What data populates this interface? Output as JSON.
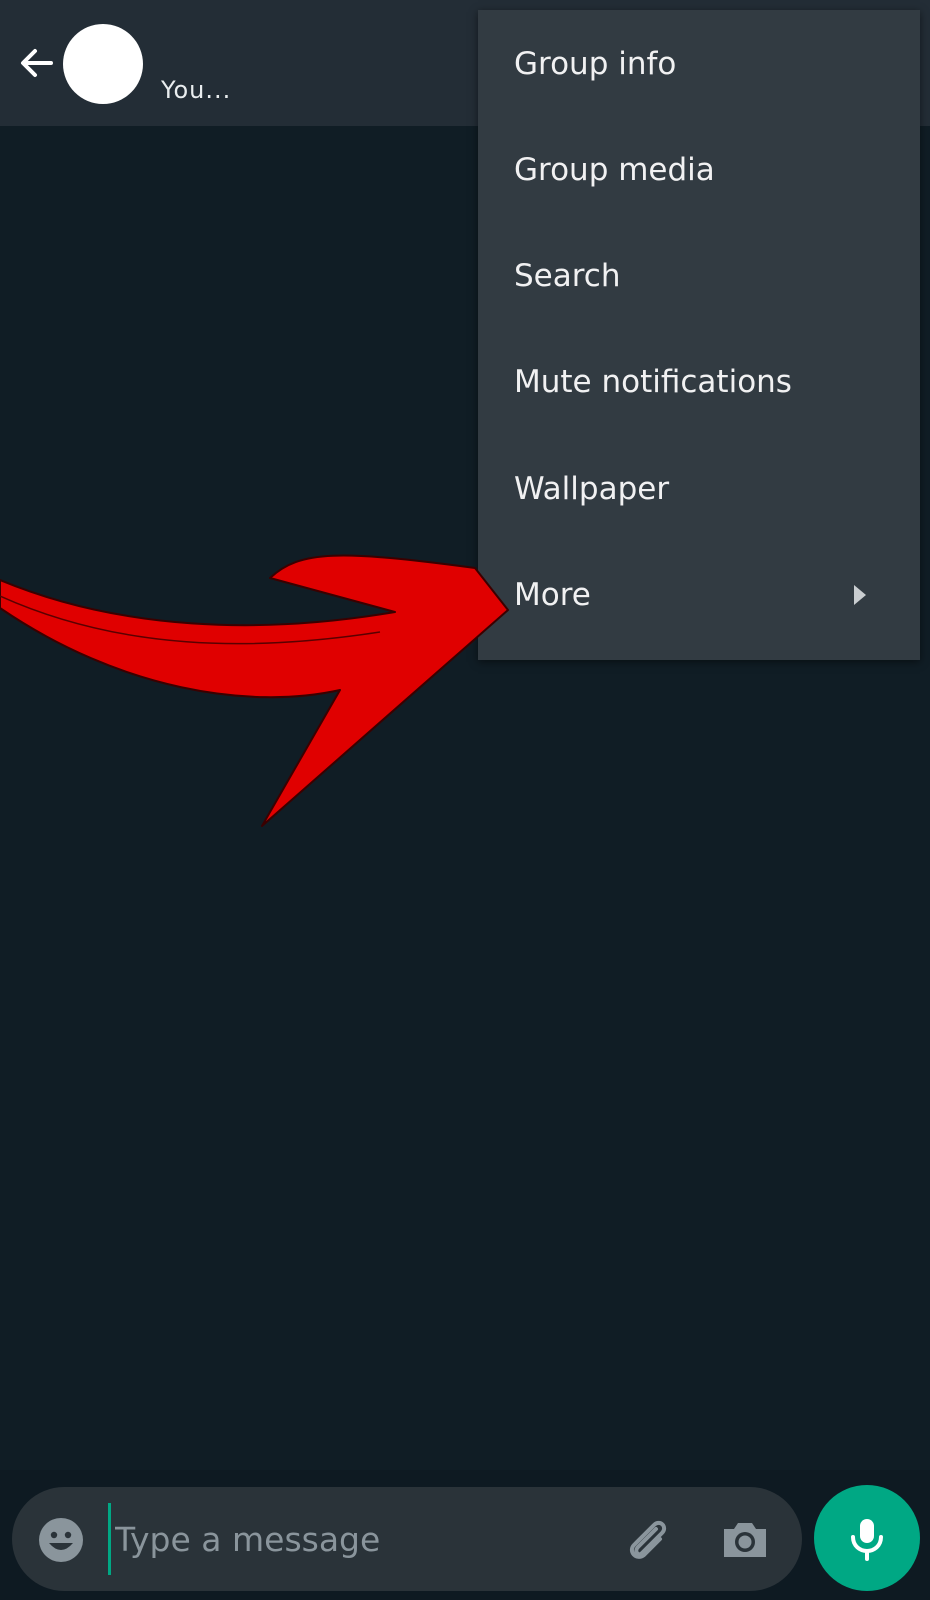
{
  "header": {
    "subtitle": "You..."
  },
  "menu": {
    "items": [
      {
        "label": "Group info"
      },
      {
        "label": "Group media"
      },
      {
        "label": "Search"
      },
      {
        "label": "Mute notifications"
      },
      {
        "label": "Wallpaper"
      },
      {
        "label": "More",
        "has_submenu": true
      }
    ]
  },
  "composer": {
    "placeholder": "Type a message"
  },
  "colors": {
    "background": "#101d25",
    "header": "#232d36",
    "menu": "#323b42",
    "accent": "#00a884",
    "annotation_arrow": "#e00000"
  },
  "icons": {
    "back": "arrow-left-icon",
    "emoji": "emoji-icon",
    "attach": "paperclip-icon",
    "camera": "camera-icon",
    "mic": "microphone-icon",
    "submenu": "caret-right-icon"
  }
}
